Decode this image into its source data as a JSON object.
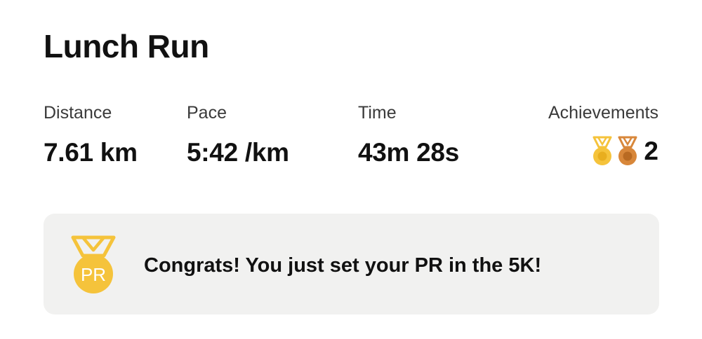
{
  "activity": {
    "title": "Lunch Run"
  },
  "stats": {
    "distance": {
      "label": "Distance",
      "value": "7.61 km"
    },
    "pace": {
      "label": "Pace",
      "value": "5:42 /km"
    },
    "time": {
      "label": "Time",
      "value": "43m 28s"
    },
    "achievements": {
      "label": "Achievements",
      "count": "2",
      "icons": [
        "gold-medal-icon",
        "bronze-medal-icon"
      ]
    }
  },
  "pr_banner": {
    "message": "Congrats! You just set your PR in the 5K!",
    "badge_text": "PR",
    "icon": "pr-medal-icon"
  },
  "colors": {
    "gold": "#F5C33B",
    "gold_dark": "#E8AE1F",
    "bronze": "#D8873A",
    "bronze_dark": "#B96A22",
    "banner_bg": "#F1F1F0",
    "text": "#111111"
  }
}
